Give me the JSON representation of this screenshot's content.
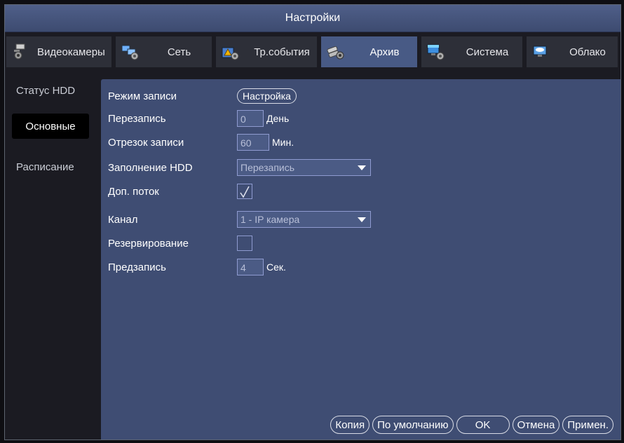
{
  "window": {
    "title": "Настройки"
  },
  "tabs": [
    {
      "label": "Видеокамеры",
      "icon": "camera-settings-icon"
    },
    {
      "label": "Сеть",
      "icon": "network-icon"
    },
    {
      "label": "Тр.события",
      "icon": "alarm-events-icon"
    },
    {
      "label": "Архив",
      "icon": "archive-storage-icon"
    },
    {
      "label": "Система",
      "icon": "system-icon"
    },
    {
      "label": "Облако",
      "icon": "cloud-icon"
    }
  ],
  "sidebar": {
    "items": [
      {
        "label": "Статус HDD"
      },
      {
        "label": "Основные"
      },
      {
        "label": "Расписание"
      }
    ]
  },
  "form": {
    "record_mode": {
      "label": "Режим записи",
      "button": "Настройка"
    },
    "overwrite": {
      "label": "Перезапись",
      "value": "0",
      "unit": "День"
    },
    "segment": {
      "label": "Отрезок записи",
      "value": "60",
      "unit": "Мин."
    },
    "hdd_full": {
      "label": "Заполнение HDD",
      "value": "Перезапись"
    },
    "sub_stream": {
      "label": "Доп. поток",
      "checked": true
    },
    "channel": {
      "label": "Канал",
      "value": "1 - IP камера"
    },
    "backup": {
      "label": "Резервирование",
      "checked": false
    },
    "pre_record": {
      "label": "Предзапись",
      "value": "4",
      "unit": "Сек."
    }
  },
  "footer": {
    "copy": "Копия",
    "default": "По умолчанию",
    "ok": "OK",
    "cancel": "Отмена",
    "apply": "Примен."
  },
  "colors": {
    "titlebar": "#4f5f89",
    "panel": "#3f4d73",
    "active_tab": "#485a85",
    "tab": "#2d2f38",
    "field_border": "#8f9bd0"
  }
}
